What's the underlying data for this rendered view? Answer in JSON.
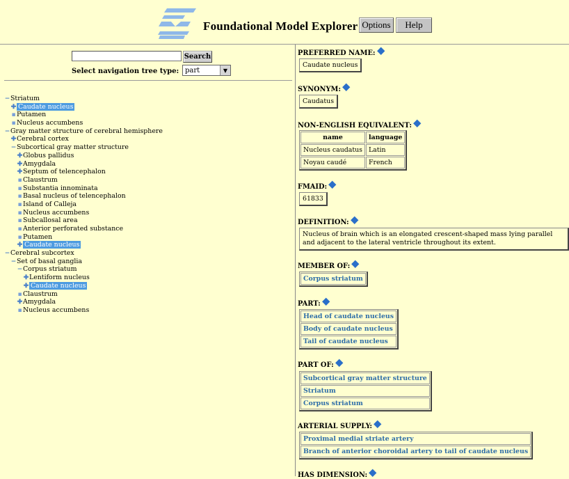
{
  "header": {
    "title": "Foundational Model Explorer",
    "options_label": "Options",
    "help_label": "Help"
  },
  "search": {
    "value": "",
    "button_label": "Search",
    "nav_type_label": "Select navigation tree type:",
    "nav_type_value": "part"
  },
  "tree": [
    {
      "label": "Striatum",
      "marker": "minus",
      "depth": 0,
      "selected": false
    },
    {
      "label": "Caudate nucleus",
      "marker": "plus",
      "depth": 1,
      "selected": true
    },
    {
      "label": "Putamen",
      "marker": "dot",
      "depth": 1,
      "selected": false
    },
    {
      "label": "Nucleus accumbens",
      "marker": "dot",
      "depth": 1,
      "selected": false
    },
    {
      "label": "Gray matter structure of cerebral hemisphere",
      "marker": "minus",
      "depth": 0,
      "selected": false
    },
    {
      "label": "Cerebral cortex",
      "marker": "plus",
      "depth": 1,
      "selected": false
    },
    {
      "label": "Subcortical gray matter structure",
      "marker": "minus",
      "depth": 1,
      "selected": false
    },
    {
      "label": "Globus pallidus",
      "marker": "plus",
      "depth": 2,
      "selected": false
    },
    {
      "label": "Amygdala",
      "marker": "plus",
      "depth": 2,
      "selected": false
    },
    {
      "label": "Septum of telencephalon",
      "marker": "plus",
      "depth": 2,
      "selected": false
    },
    {
      "label": "Claustrum",
      "marker": "dot",
      "depth": 2,
      "selected": false
    },
    {
      "label": "Substantia innominata",
      "marker": "dot",
      "depth": 2,
      "selected": false
    },
    {
      "label": "Basal nucleus of telencephalon",
      "marker": "dot",
      "depth": 2,
      "selected": false
    },
    {
      "label": "Island of Calleja",
      "marker": "dot",
      "depth": 2,
      "selected": false
    },
    {
      "label": "Nucleus accumbens",
      "marker": "dot",
      "depth": 2,
      "selected": false
    },
    {
      "label": "Subcallosal area",
      "marker": "dot",
      "depth": 2,
      "selected": false
    },
    {
      "label": "Anterior perforated substance",
      "marker": "dot",
      "depth": 2,
      "selected": false
    },
    {
      "label": "Putamen",
      "marker": "dot",
      "depth": 2,
      "selected": false
    },
    {
      "label": "Caudate nucleus",
      "marker": "plus",
      "depth": 2,
      "selected": true
    },
    {
      "label": "Cerebral subcortex",
      "marker": "minus",
      "depth": 0,
      "selected": false
    },
    {
      "label": "Set of basal ganglia",
      "marker": "minus",
      "depth": 1,
      "selected": false
    },
    {
      "label": "Corpus striatum",
      "marker": "minus",
      "depth": 2,
      "selected": false
    },
    {
      "label": "Lentiform nucleus",
      "marker": "plus",
      "depth": 3,
      "selected": false
    },
    {
      "label": "Caudate nucleus",
      "marker": "plus",
      "depth": 3,
      "selected": true
    },
    {
      "label": "Claustrum",
      "marker": "dot",
      "depth": 2,
      "selected": false
    },
    {
      "label": "Amygdala",
      "marker": "plus",
      "depth": 2,
      "selected": false
    },
    {
      "label": "Nucleus accumbens",
      "marker": "dot",
      "depth": 2,
      "selected": false
    }
  ],
  "details": {
    "preferred_name": {
      "title": "PREFERRED NAME:",
      "value": "Caudate nucleus"
    },
    "synonym": {
      "title": "SYNONYM:",
      "value": "Caudatus"
    },
    "non_english": {
      "title": "NON-ENGLISH EQUIVALENT:",
      "headers": [
        "name",
        "language"
      ],
      "rows": [
        [
          "Nucleus caudatus",
          "Latin"
        ],
        [
          "Noyau caudé",
          "French"
        ]
      ]
    },
    "fmaid": {
      "title": "FMAID:",
      "value": "61833"
    },
    "definition": {
      "title": "DEFINITION:",
      "value": "Nucleus of brain which is an elongated crescent-shaped mass lying parallel and adjacent to the lateral ventricle throughout its extent."
    },
    "member_of": {
      "title": "MEMBER OF:",
      "items": [
        "Corpus striatum"
      ]
    },
    "part": {
      "title": "PART:",
      "items": [
        "Head of caudate nucleus",
        "Body of caudate nucleus",
        "Tail of caudate nucleus"
      ]
    },
    "part_of": {
      "title": "PART OF:",
      "items": [
        "Subcortical gray matter structure",
        "Striatum",
        "Corpus striatum"
      ]
    },
    "arterial_supply": {
      "title": "ARTERIAL SUPPLY:",
      "items": [
        "Proximal medial striate artery",
        "Branch of anterior choroidal artery to tail of caudate nucleus"
      ]
    },
    "has_dimension": {
      "title": "HAS DIMENSION:"
    }
  },
  "colors": {
    "background": "#ffffd0",
    "selection": "#4d9be0",
    "link": "#2e6da8",
    "info_icon": "#2a6fc9"
  }
}
